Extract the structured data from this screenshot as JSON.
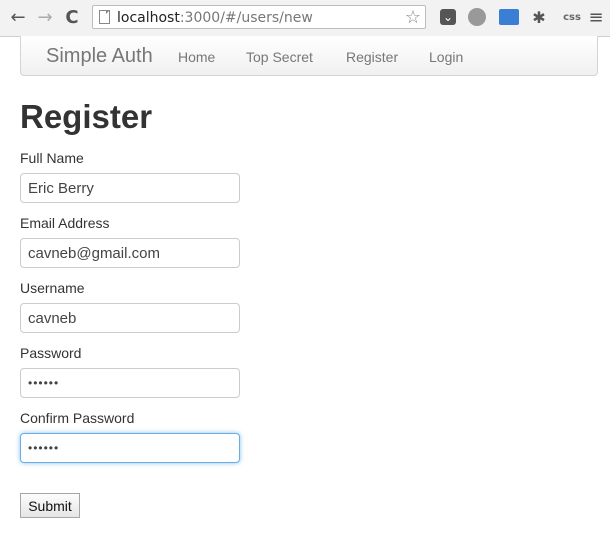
{
  "browser": {
    "back_glyph": "←",
    "forward_glyph": "→",
    "reload_glyph": "C",
    "url_host": "localhost",
    "url_rest": ":3000/#/users/new",
    "bookmark_glyph": "☆",
    "extensions": {
      "css_label": "css",
      "menu_glyph": "≡",
      "gear_glyph": "✱"
    }
  },
  "navbar": {
    "brand": "Simple Auth",
    "links": [
      "Home",
      "Top Secret",
      "Register",
      "Login"
    ]
  },
  "form": {
    "title": "Register",
    "fields": [
      {
        "label": "Full Name",
        "value": "Eric Berry"
      },
      {
        "label": "Email Address",
        "value": "cavneb@gmail.com"
      },
      {
        "label": "Username",
        "value": "cavneb"
      },
      {
        "label": "Password",
        "value": "••••••"
      },
      {
        "label": "Confirm Password",
        "value": "••••••"
      }
    ],
    "submit_label": "Submit"
  }
}
